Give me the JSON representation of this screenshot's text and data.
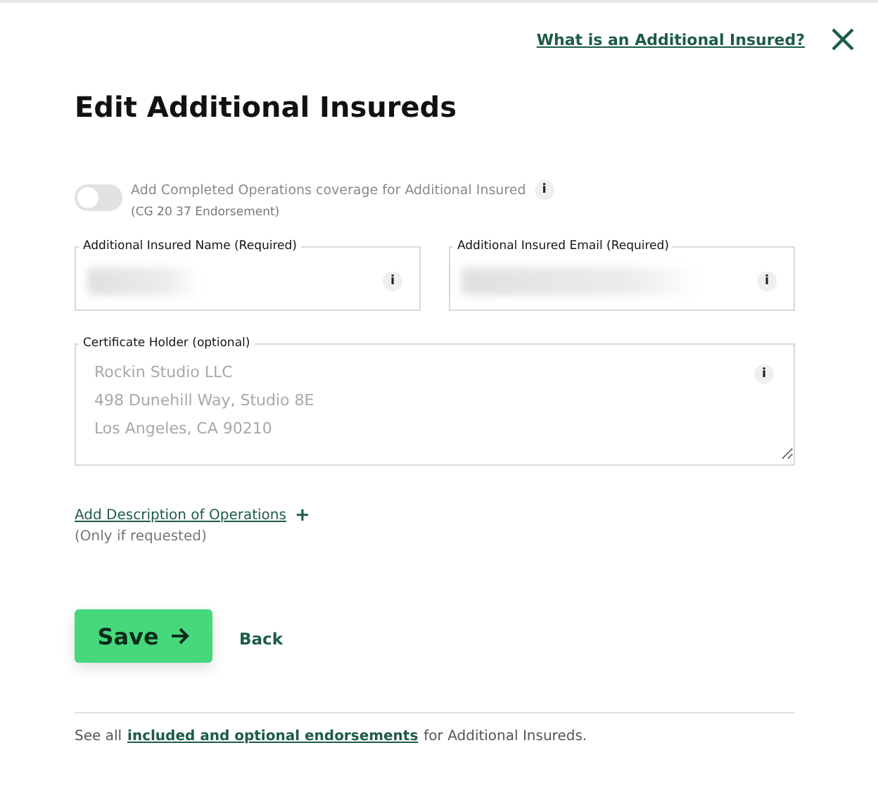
{
  "header": {
    "help_link": "What is an Additional Insured?"
  },
  "title": "Edit Additional Insureds",
  "completed_operations": {
    "label": "Add Completed Operations coverage for Additional Insured",
    "info": "i",
    "note": "(CG 20 37 Endorsement)",
    "on": false
  },
  "fields": [
    {
      "label": "Additional Insured Name (Required)",
      "info": "i",
      "redacted": true
    },
    {
      "label": "Additional Insured Email (Required)",
      "info": "i",
      "redacted": true
    }
  ],
  "certificate_holder": {
    "label": "Certificate Holder (optional)",
    "info": "i",
    "placeholder": "Rockin Studio LLC\n498 Dunehill Way, Studio 8E\nLos Angeles, CA 90210"
  },
  "description": {
    "link": "Add Description of Operations",
    "plus": "+",
    "note": "(Only if requested)"
  },
  "buttons": {
    "save": "Save",
    "back": "Back"
  },
  "footer": {
    "prefix": "See all",
    "link": "included and optional endorsements",
    "suffix": "for Additional Insureds."
  }
}
